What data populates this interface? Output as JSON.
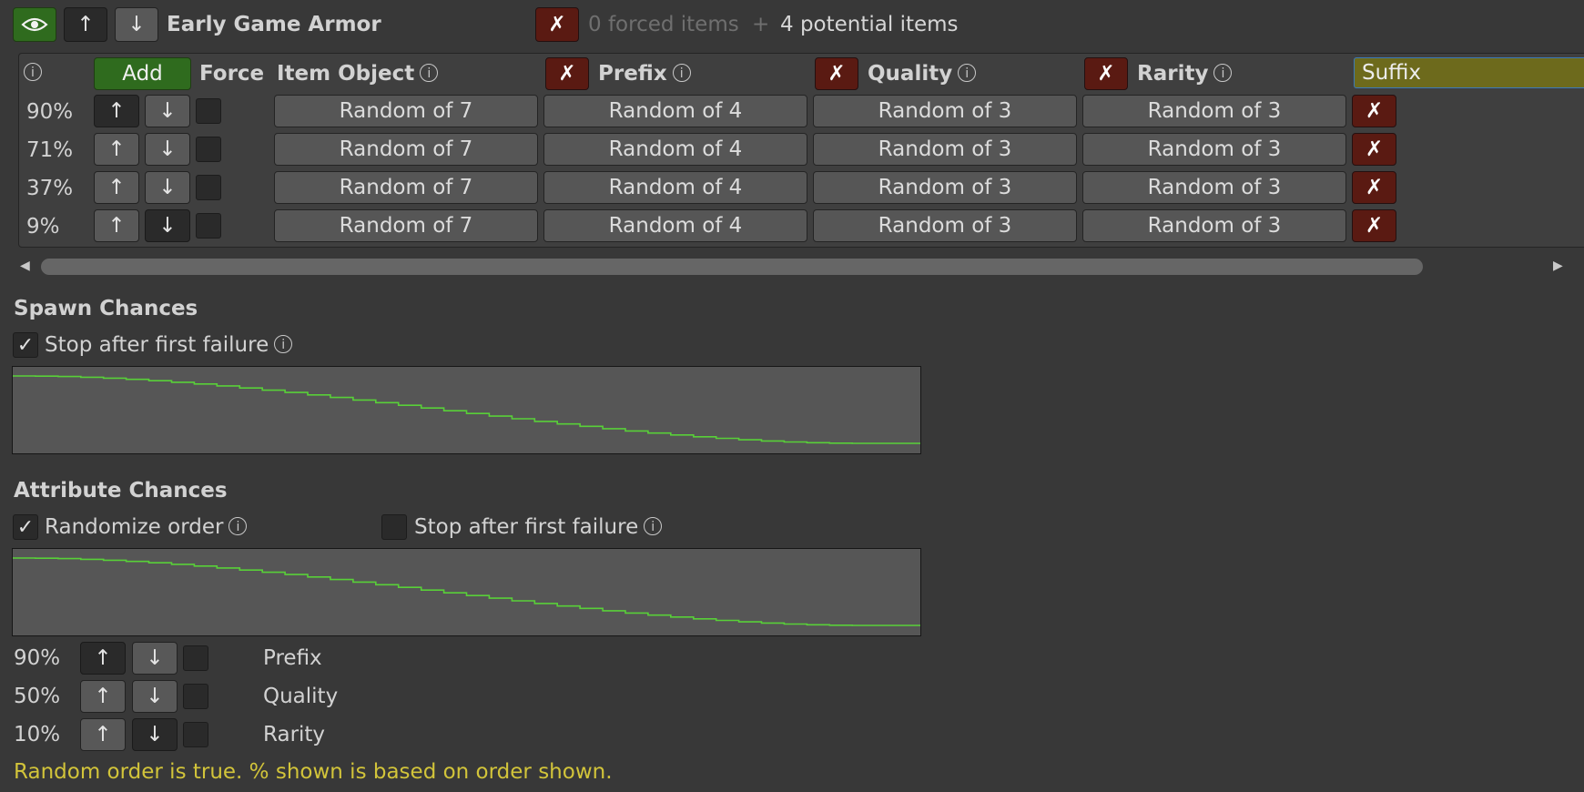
{
  "header": {
    "title": "Early Game Armor",
    "forced_items": "0 forced items",
    "plus": "+",
    "potential_items": "4 potential items"
  },
  "table": {
    "add_label": "Add",
    "force_label": "Force",
    "columns": {
      "item_object": "Item Object",
      "prefix": "Prefix",
      "quality": "Quality",
      "rarity": "Rarity"
    },
    "suffix_input_value": "Suffix",
    "rows": [
      {
        "percent": "90%",
        "item_object": "Random of 7",
        "prefix": "Random of 4",
        "quality": "Random of 3",
        "rarity": "Random of 3"
      },
      {
        "percent": "71%",
        "item_object": "Random of 7",
        "prefix": "Random of 4",
        "quality": "Random of 3",
        "rarity": "Random of 3"
      },
      {
        "percent": "37%",
        "item_object": "Random of 7",
        "prefix": "Random of 4",
        "quality": "Random of 3",
        "rarity": "Random of 3"
      },
      {
        "percent": "9%",
        "item_object": "Random of 7",
        "prefix": "Random of 4",
        "quality": "Random of 3",
        "rarity": "Random of 3"
      }
    ]
  },
  "spawn": {
    "title": "Spawn Chances",
    "stop_after_failure_label": "Stop after first failure",
    "stop_after_failure_checked": true
  },
  "attribute": {
    "title": "Attribute Chances",
    "randomize_label": "Randomize order",
    "randomize_checked": true,
    "stop_after_failure_label": "Stop after first failure",
    "stop_after_failure_checked": false,
    "rows": [
      {
        "percent": "90%",
        "name": "Prefix"
      },
      {
        "percent": "50%",
        "name": "Quality"
      },
      {
        "percent": "10%",
        "name": "Rarity"
      }
    ]
  },
  "note": "Random order is true. % shown is based on order shown.",
  "glyphs": {
    "up": "↑",
    "down": "↓",
    "remove": "✗",
    "check": "✓",
    "info": "i",
    "scroll_left": "◀",
    "scroll_right": "▶"
  },
  "colors": {
    "accent_green": "#2f6b1e",
    "remove_red": "#5a1a12",
    "curve_green": "#58d038",
    "note_yellow": "#d2c43a",
    "suffix_field": "#6d6a1c"
  }
}
